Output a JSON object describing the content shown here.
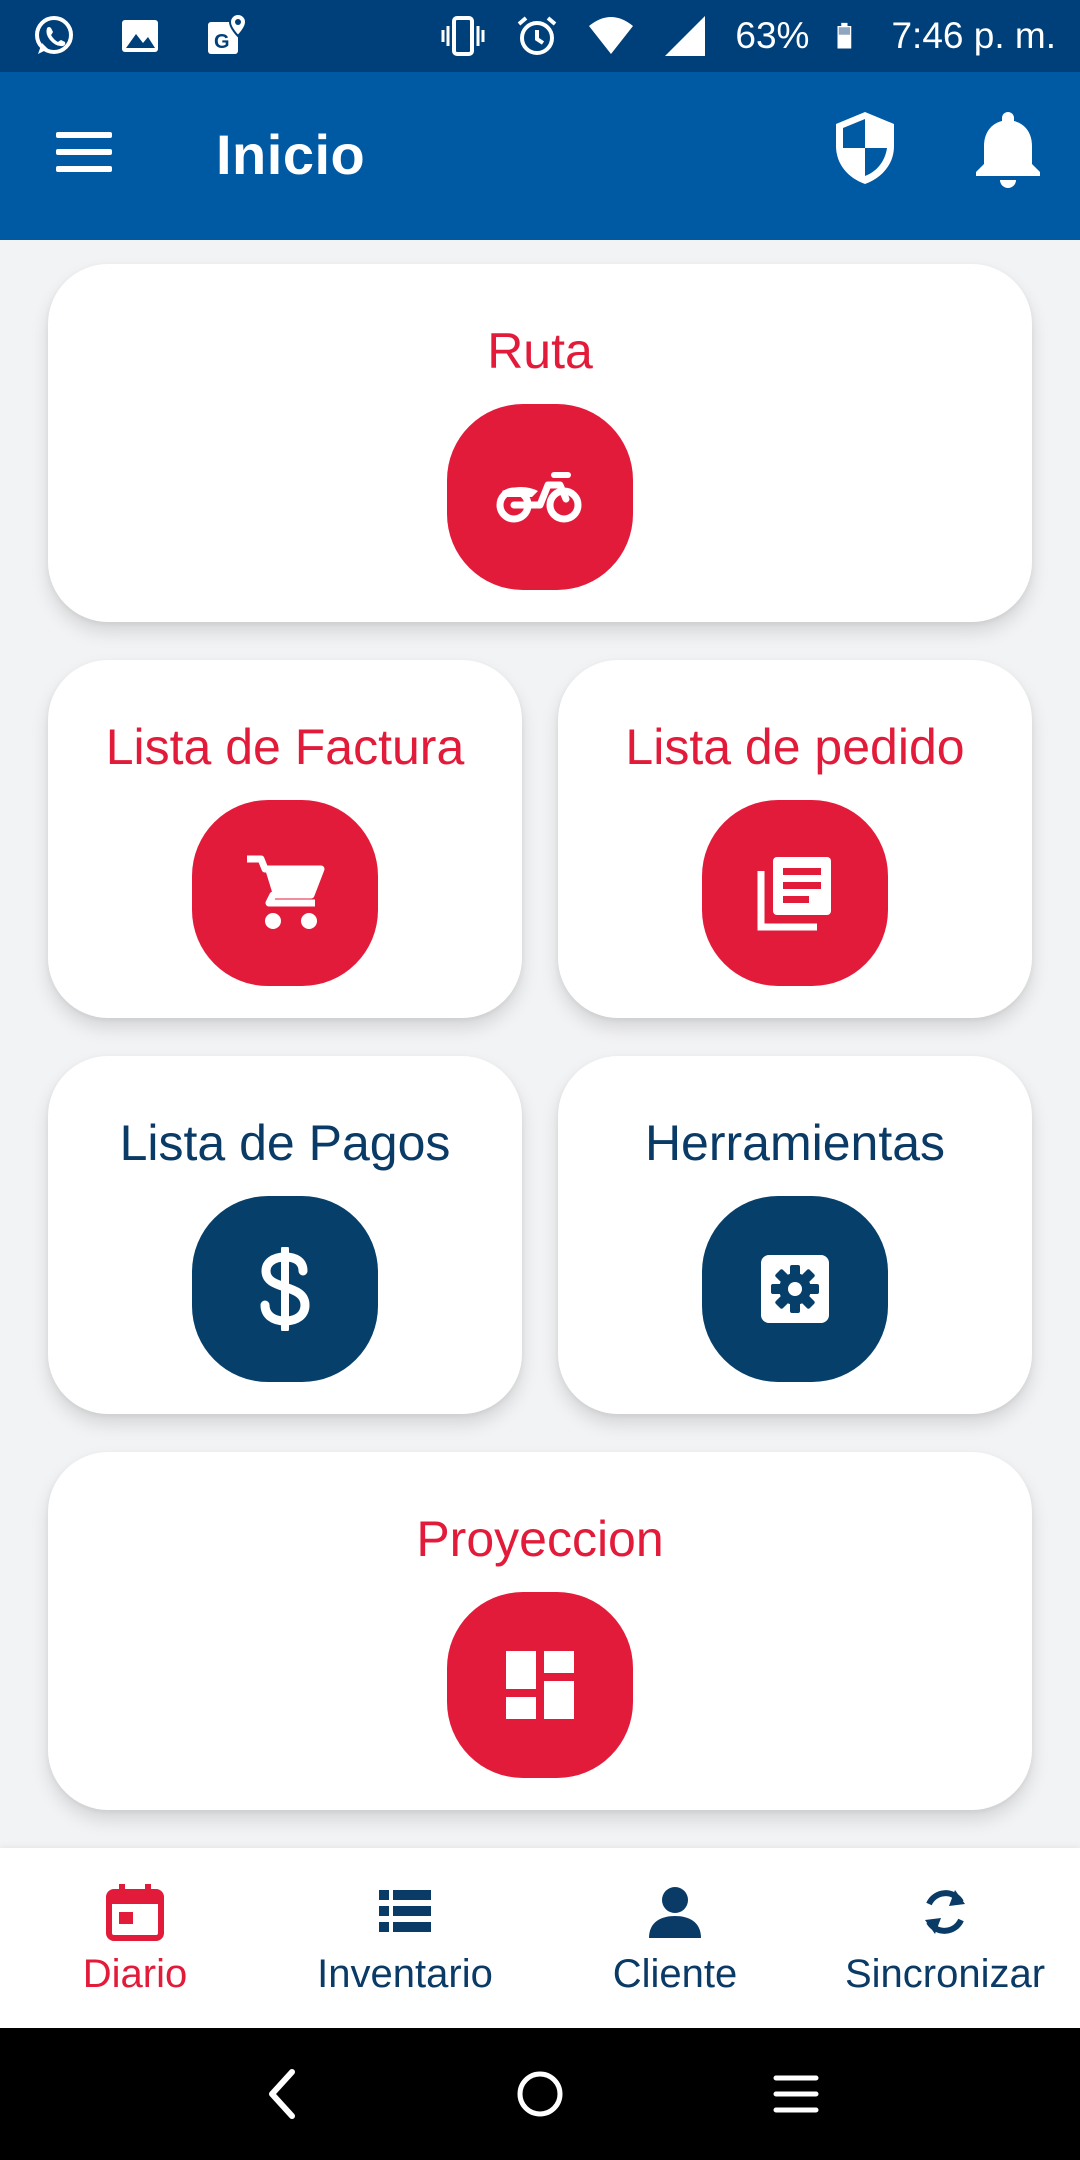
{
  "status_bar": {
    "battery": "63%",
    "time": "7:46 p. m.",
    "left_icons": [
      "whatsapp-icon",
      "gallery-icon",
      "maps-icon"
    ],
    "right_icons": [
      "vibrate-icon",
      "alarm-icon",
      "wifi-icon",
      "signal-icon",
      "battery-icon"
    ]
  },
  "app_bar": {
    "title": "Inicio",
    "icons": [
      "menu-icon",
      "shield-icon",
      "bell-icon"
    ]
  },
  "cards": [
    {
      "id": "ruta",
      "label": "Ruta",
      "color": "#e31b3a",
      "icon": "motorcycle-icon"
    },
    {
      "id": "factura",
      "label": "Lista de Factura",
      "color": "#e31b3a",
      "icon": "cart-icon"
    },
    {
      "id": "pedido",
      "label": "Lista de pedido",
      "color": "#e31b3a",
      "icon": "list-document-icon"
    },
    {
      "id": "pagos",
      "label": "Lista de Pagos",
      "color": "#053f6a",
      "icon": "dollar-icon"
    },
    {
      "id": "herramientas",
      "label": "Herramientas",
      "color": "#053f6a",
      "icon": "gear-icon"
    },
    {
      "id": "proyeccion",
      "label": "Proyeccion",
      "color": "#e31b3a",
      "icon": "dashboard-icon"
    }
  ],
  "bottom_nav": {
    "active": "Diario",
    "items": [
      {
        "label": "Diario",
        "icon": "calendar-icon"
      },
      {
        "label": "Inventario",
        "icon": "list-icon"
      },
      {
        "label": "Cliente",
        "icon": "person-icon"
      },
      {
        "label": "Sincronizar",
        "icon": "sync-icon"
      }
    ]
  },
  "colors": {
    "status_bar": "#00407a",
    "app_bar": "#0059a3",
    "accent_red": "#e31b3a",
    "accent_blue": "#053f6a",
    "background": "#f2f3f5"
  }
}
